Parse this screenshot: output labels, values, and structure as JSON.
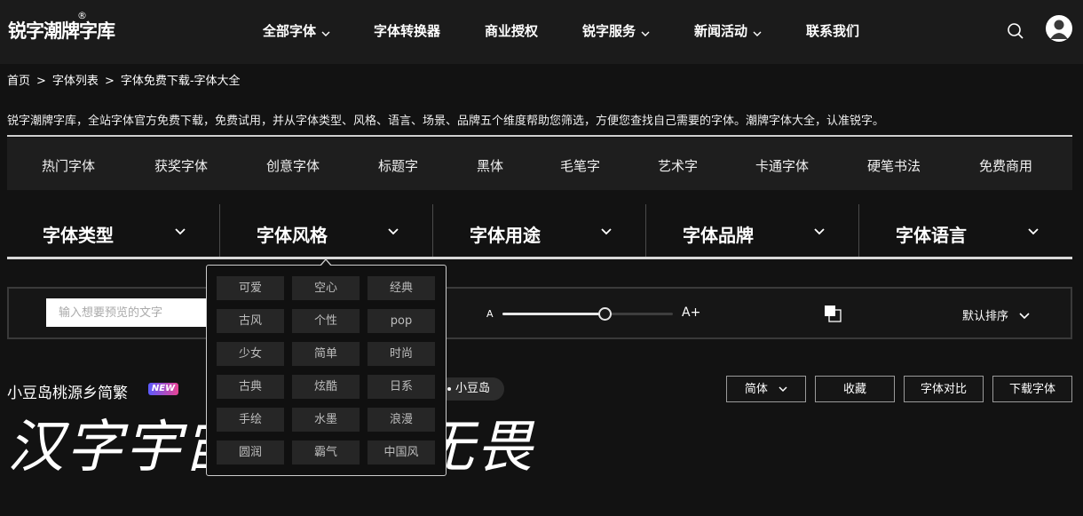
{
  "header": {
    "logo": "锐字潮牌字库",
    "logo_mark": "®",
    "nav": [
      {
        "label": "全部字体",
        "has_dropdown": true
      },
      {
        "label": "字体转换器",
        "has_dropdown": false
      },
      {
        "label": "商业授权",
        "has_dropdown": false
      },
      {
        "label": "锐字服务",
        "has_dropdown": true
      },
      {
        "label": "新闻活动",
        "has_dropdown": true
      },
      {
        "label": "联系我们",
        "has_dropdown": false
      }
    ],
    "icons": {
      "search": "search-icon",
      "user": "user-icon"
    }
  },
  "breadcrumb": {
    "items": [
      "首页",
      "字体列表",
      "字体免费下载-字体大全"
    ],
    "separator": ">"
  },
  "intro": "锐字潮牌字库，全站字体官方免费下载，免费试用，并从字体类型、风格、语言、场景、品牌五个维度帮助您筛选，方便您查找自己需要的字体。潮牌字体大全，认准锐字。",
  "categories": [
    "热门字体",
    "获奖字体",
    "创意字体",
    "标题字",
    "黑体",
    "毛笔字",
    "艺术字",
    "卡通字体",
    "硬笔书法",
    "免费商用"
  ],
  "filters": [
    "字体类型",
    "字体风格",
    "字体用途",
    "字体品牌",
    "字体语言"
  ],
  "style_dropdown": {
    "options": [
      "可爱",
      "空心",
      "经典",
      "古风",
      "个性",
      "pop",
      "少女",
      "简单",
      "时尚",
      "古典",
      "炫酷",
      "日系",
      "手绘",
      "水墨",
      "浪漫",
      "圆润",
      "霸气",
      "中国风"
    ]
  },
  "toolbar": {
    "preview_placeholder": "输入想要预览的文字",
    "size_small": "A",
    "size_large": "A+",
    "size_level_fraction": 0.6,
    "sort_label": "默认排序"
  },
  "font_item": {
    "name": "小豆岛桃源乡简繁",
    "badge": "NEW",
    "brand": "小豆岛",
    "buttons": {
      "variant": "简体",
      "favorite": "收藏",
      "compare": "字体对比",
      "download": "下载字体"
    },
    "sample_text": "汉字宇宙先锋且无畏"
  },
  "colors": {
    "background": "#121212",
    "header": "#1b1b1b",
    "badge_gradient_start": "#5b5bff",
    "badge_gradient_end": "#e84393"
  }
}
